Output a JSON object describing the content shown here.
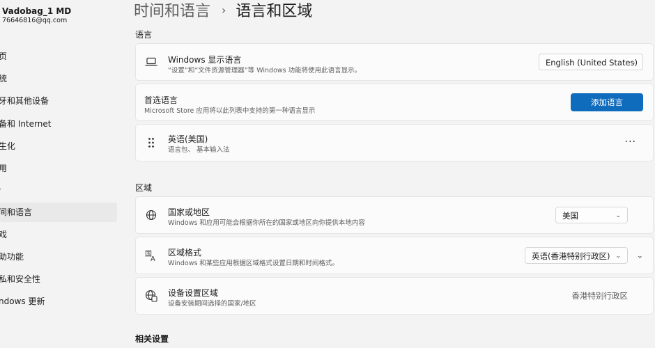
{
  "sidebar": {
    "user_name": "Vadobag_1 MD",
    "user_email": "76646816@qq.com",
    "items": [
      {
        "label": "页"
      },
      {
        "label": "统"
      },
      {
        "label": "牙和其他设备"
      },
      {
        "label": "备和 Internet"
      },
      {
        "label": "生化"
      },
      {
        "label": "用"
      },
      {
        "label": "·"
      },
      {
        "label": "间和语言"
      },
      {
        "label": "戏"
      },
      {
        "label": "助功能"
      },
      {
        "label": "私和安全性"
      },
      {
        "label": "ndows 更新"
      }
    ]
  },
  "header": {
    "parent": "时间和语言",
    "separator": "›",
    "current": "语言和区域"
  },
  "language_section": {
    "title": "语言",
    "display_language": {
      "title": "Windows 显示语言",
      "subtitle": "“设置”和“文件资源管理器”等 Windows 功能将使用此语言显示。",
      "value": "English (United States)",
      "icon": "laptop-icon"
    },
    "preferred": {
      "title": "首选语言",
      "subtitle": "Microsoft Store 应用将以此列表中支持的第一种语言显示",
      "button": "添加语言"
    },
    "language_item": {
      "title": "英语(美国)",
      "subtitle": "语言包、 基本输入法",
      "more": "···",
      "icon": "drag-handle-icon"
    }
  },
  "region_section": {
    "title": "区域",
    "country": {
      "title": "国家或地区",
      "subtitle": "Windows 和应用可能会根据你所在的国家或地区向你提供本地内容",
      "value": "美国",
      "icon": "globe-icon"
    },
    "format": {
      "title": "区域格式",
      "subtitle": "Windows 和某些应用根据区域格式设置日期和时间格式。",
      "value": "英语(香港特别行政区)",
      "icon": "language-format-icon"
    },
    "device_region": {
      "title": "设备设置区域",
      "subtitle": "设备安装期间选择的国家/地区",
      "value": "香港特别行政区",
      "icon": "globe-device-icon"
    }
  },
  "related": {
    "title": "相关设置"
  },
  "colors": {
    "accent": "#0f6cbd",
    "background": "#f3f3f3",
    "card": "#fbfbfb"
  }
}
